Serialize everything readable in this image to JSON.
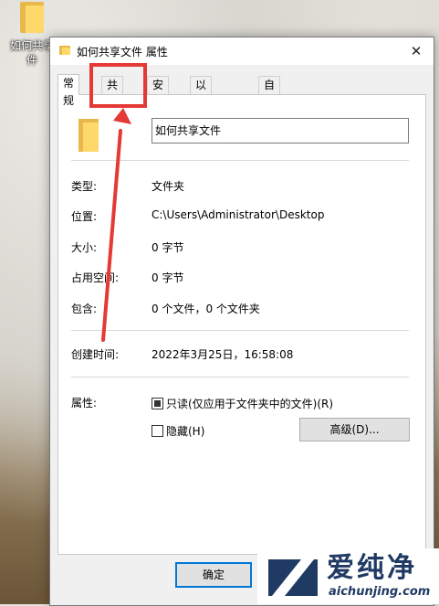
{
  "desktop": {
    "icon_label": "如何共享\n件"
  },
  "window": {
    "title": "如何共享文件 属性",
    "close_glyph": "✕"
  },
  "tabs": [
    {
      "label": "常规"
    },
    {
      "label": "共享"
    },
    {
      "label": "安全"
    },
    {
      "label": "以前的版本"
    },
    {
      "label": "自定义"
    }
  ],
  "general": {
    "name_value": "如何共享文件",
    "rows": [
      {
        "label": "类型:",
        "value": "文件夹"
      },
      {
        "label": "位置:",
        "value": "C:\\Users\\Administrator\\Desktop"
      },
      {
        "label": "大小:",
        "value": "0 字节"
      },
      {
        "label": "占用空间:",
        "value": "0 字节"
      },
      {
        "label": "包含:",
        "value": "0 个文件，0 个文件夹"
      },
      {
        "label": "创建时间:",
        "value": "2022年3月25日，16:58:08"
      }
    ],
    "attributes_label": "属性:",
    "readonly_label": "只读(仅应用于文件夹中的文件)(R)",
    "readonly_state": "mixed",
    "hidden_label": "隐藏(H)",
    "hidden_state": "unchecked",
    "advanced_button": "高级(D)..."
  },
  "footer": {
    "ok_button": "确定"
  },
  "annotation": {
    "highlight_color": "#e53935",
    "target": "共享"
  },
  "watermark": {
    "chinese": "爱纯净",
    "domain": "aichunjing.com",
    "color": "#1f3a63"
  }
}
